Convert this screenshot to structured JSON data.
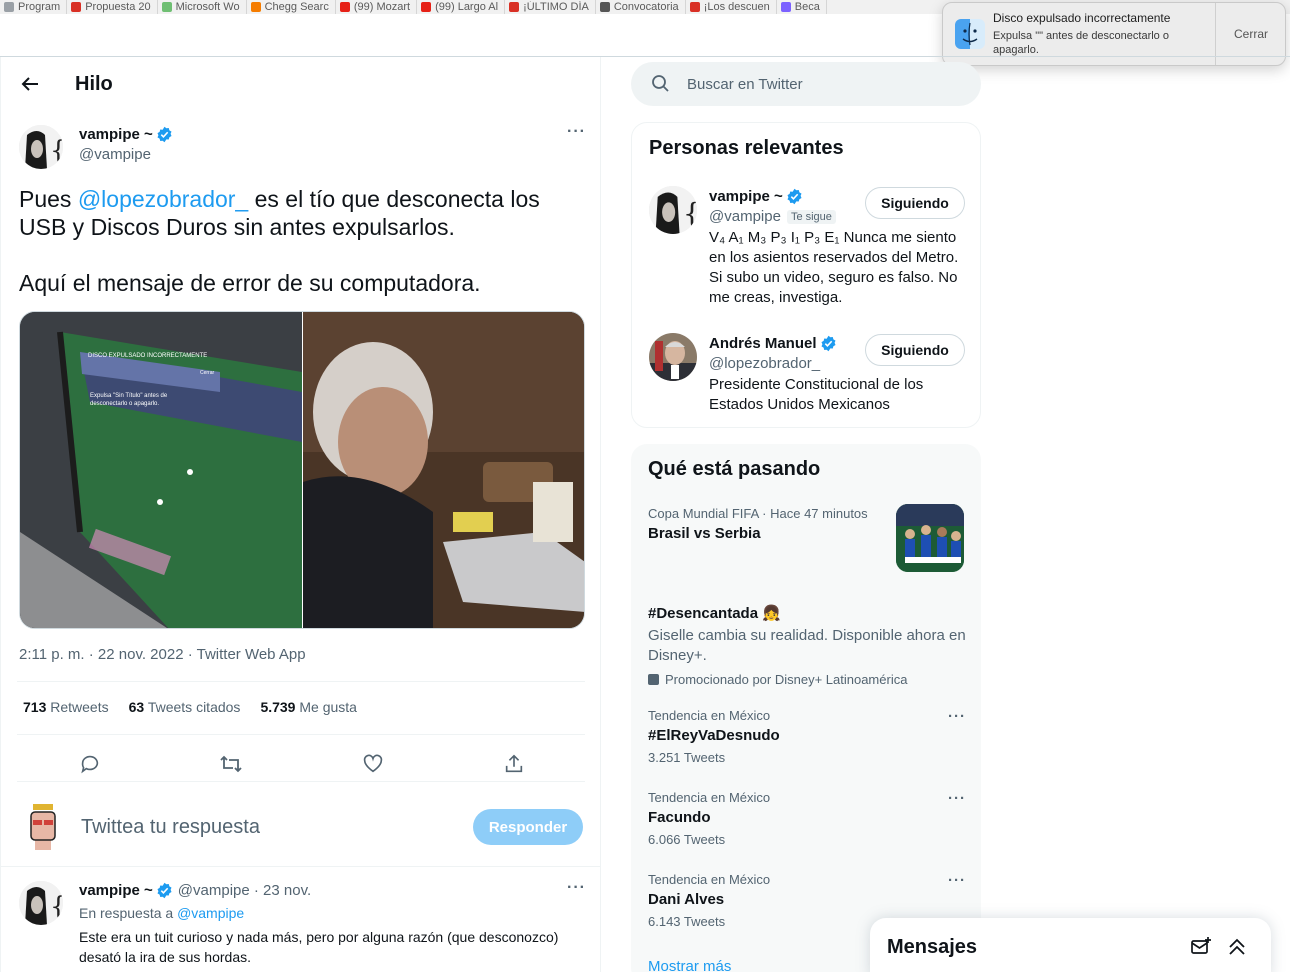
{
  "bookmarks": [
    {
      "label": "Program",
      "color": "#9aa0a6"
    },
    {
      "label": "Propuesta 20",
      "color": "#d93025"
    },
    {
      "label": "Microsoft Wo",
      "color": "#6fbf73"
    },
    {
      "label": "Chegg Searc",
      "color": "#f57c00"
    },
    {
      "label": "(99) Mozart",
      "color": "#e62117"
    },
    {
      "label": "(99) Largo Al",
      "color": "#e62117"
    },
    {
      "label": "¡ÚLTIMO DÍA",
      "color": "#d93025"
    },
    {
      "label": "Convocatoria",
      "color": "#555555"
    },
    {
      "label": "¡Los descuen",
      "color": "#d93025"
    },
    {
      "label": "Beca",
      "color": "#7b61ff"
    }
  ],
  "thread": {
    "title": "Hilo",
    "author": {
      "name": "vampipe ~",
      "handle": "@vampipe"
    },
    "text_pre": "Pues ",
    "mention": "@lopezobrador_",
    "text_post": " es el tío que desconecta los USB y Discos Duros sin antes expulsarlos.",
    "text_second": "Aquí el mensaje de error de su computadora.",
    "media_overlay": {
      "title": "DISCO EXPULSADO INCORRECTAMENTE",
      "body": "Expulsa \"Sin Título\" antes de desconectarlo o apagarlo.",
      "close": "Cerrar"
    },
    "timestamp": "2:11 p. m. · 22 nov. 2022 · Twitter Web App",
    "stats": {
      "retweets_count": "713",
      "retweets_label": "Retweets",
      "quotes_count": "63",
      "quotes_label": "Tweets citados",
      "likes_count": "5.739",
      "likes_label": "Me gusta"
    },
    "reply_placeholder": "Twittea tu respuesta",
    "reply_button": "Responder"
  },
  "reply_tweet": {
    "name": "vampipe ~",
    "handle_time": "@vampipe · 23 nov.",
    "in_reply_prefix": "En respuesta a ",
    "in_reply_handle": "@vampipe",
    "body": "Este era un tuit curioso y nada más, pero por alguna razón (que desconozco) desató la ira de sus hordas."
  },
  "search": {
    "placeholder": "Buscar en Twitter"
  },
  "relevant": {
    "title": "Personas relevantes",
    "people": [
      {
        "name": "vampipe ~",
        "handle": "@vampipe",
        "badge": "Te sigue",
        "button": "Siguiendo",
        "bio": "V₄ A₁ M₃ P₃ I₁ P₃ E₁ Nunca me siento en los asientos reservados del Metro. Si subo un video, seguro es falso. No me creas, investiga."
      },
      {
        "name": "Andrés Manuel",
        "handle": "@lopezobrador_",
        "button": "Siguiendo",
        "bio": "Presidente Constitucional de los Estados Unidos Mexicanos"
      }
    ]
  },
  "happening": {
    "title": "Qué está pasando",
    "trends": [
      {
        "context": "Copa Mundial FIFA · Hace 47 minutos",
        "title": "Brasil vs Serbia"
      },
      {
        "title": "#Desencantada 👧",
        "description": "Giselle cambia su realidad. Disponible ahora en Disney+.",
        "promoted": "Promocionado por Disney+ Latinoamérica"
      },
      {
        "context": "Tendencia en México",
        "title": "#ElReyVaDesnudo",
        "count": "3.251 Tweets"
      },
      {
        "context": "Tendencia en México",
        "title": "Facundo",
        "count": "6.066 Tweets"
      },
      {
        "context": "Tendencia en México",
        "title": "Dani Alves",
        "count": "6.143 Tweets"
      }
    ],
    "show_more": "Mostrar más"
  },
  "messages": {
    "title": "Mensajes"
  },
  "notification": {
    "title": "Disco expulsado incorrectamente",
    "body": "Expulsa \"\" antes de desconectarlo o apagarlo.",
    "close": "Cerrar"
  },
  "colors": {
    "accent": "#1d9bf0",
    "reply_button_disabled": "#8ecdf8",
    "text_secondary": "#536471"
  }
}
